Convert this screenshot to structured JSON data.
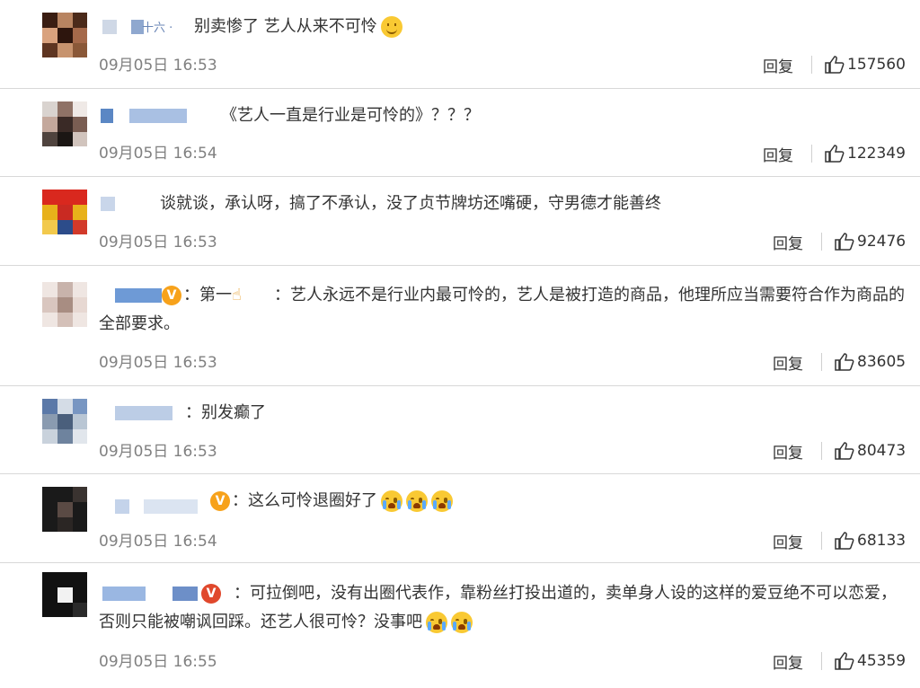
{
  "ui": {
    "reply_label": "回复"
  },
  "comments": [
    {
      "name_suffix": "十六 ·",
      "text": "别卖惨了 艺人从来不可怜",
      "time": "09月05日 16:53",
      "likes": "157560"
    },
    {
      "name_suffix": "",
      "text": "《艺人一直是行业是可怜的》？？？",
      "time": "09月05日 16:54",
      "likes": "122349"
    },
    {
      "name_suffix": "",
      "text": "谈就谈，承认呀，搞了不承认，没了贞节牌坊还嘴硬，守男德才能善终",
      "time": "09月05日 16:53",
      "likes": "92476"
    },
    {
      "name_suffix": "",
      "text_part1": "：第一",
      "text_part2": "：艺人永远不是行业内最可怜的，艺人是被打造的商品，他理所应当需要符合作为商品的全部要求。",
      "time": "09月05日 16:53",
      "likes": "83605"
    },
    {
      "name_suffix": "",
      "text": "：别发癫了",
      "time": "09月05日 16:53",
      "likes": "80473"
    },
    {
      "name_suffix": "",
      "text": "：这么可怜退圈好了",
      "time": "09月05日 16:54",
      "likes": "68133"
    },
    {
      "name_suffix": "",
      "text": "：可拉倒吧，没有出圈代表作，靠粉丝打投出道的，卖单身人设的这样的爱豆绝不可以恋爱，否则只能被嘲讽回踩。还艺人很可怜？没事吧",
      "time": "09月05日 16:55",
      "likes": "45359"
    }
  ],
  "icons": {
    "like": "thumbs-up-icon",
    "verified": "verified-badge-icon",
    "smile": "smile-emoji-icon",
    "cry": "crying-emoji-icon",
    "finger": "pointing-up-icon"
  },
  "colors": {
    "verified_badge": "#f7a21b",
    "time_gray": "#808080",
    "divider": "#d8d8d8"
  }
}
